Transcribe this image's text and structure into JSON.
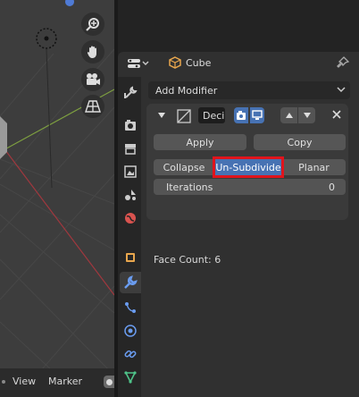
{
  "properties": {
    "object_name": "Cube",
    "add_modifier_label": "Add Modifier",
    "modifier": {
      "name": "Deci",
      "apply_label": "Apply",
      "copy_label": "Copy",
      "modes": [
        "Collapse",
        "Un-Subdivide",
        "Planar"
      ],
      "selected_mode": "Un-Subdivide",
      "iterations_label": "Iterations",
      "iterations_value": "0",
      "face_count": "Face Count: 6"
    }
  },
  "viewport": {
    "footer": {
      "view_label": "View",
      "marker_label": "Marker"
    }
  },
  "colors": {
    "accent": "#4772b3",
    "highlight": "#e0141c",
    "x_axis": "#a0383e",
    "y_axis": "#7ea040"
  }
}
